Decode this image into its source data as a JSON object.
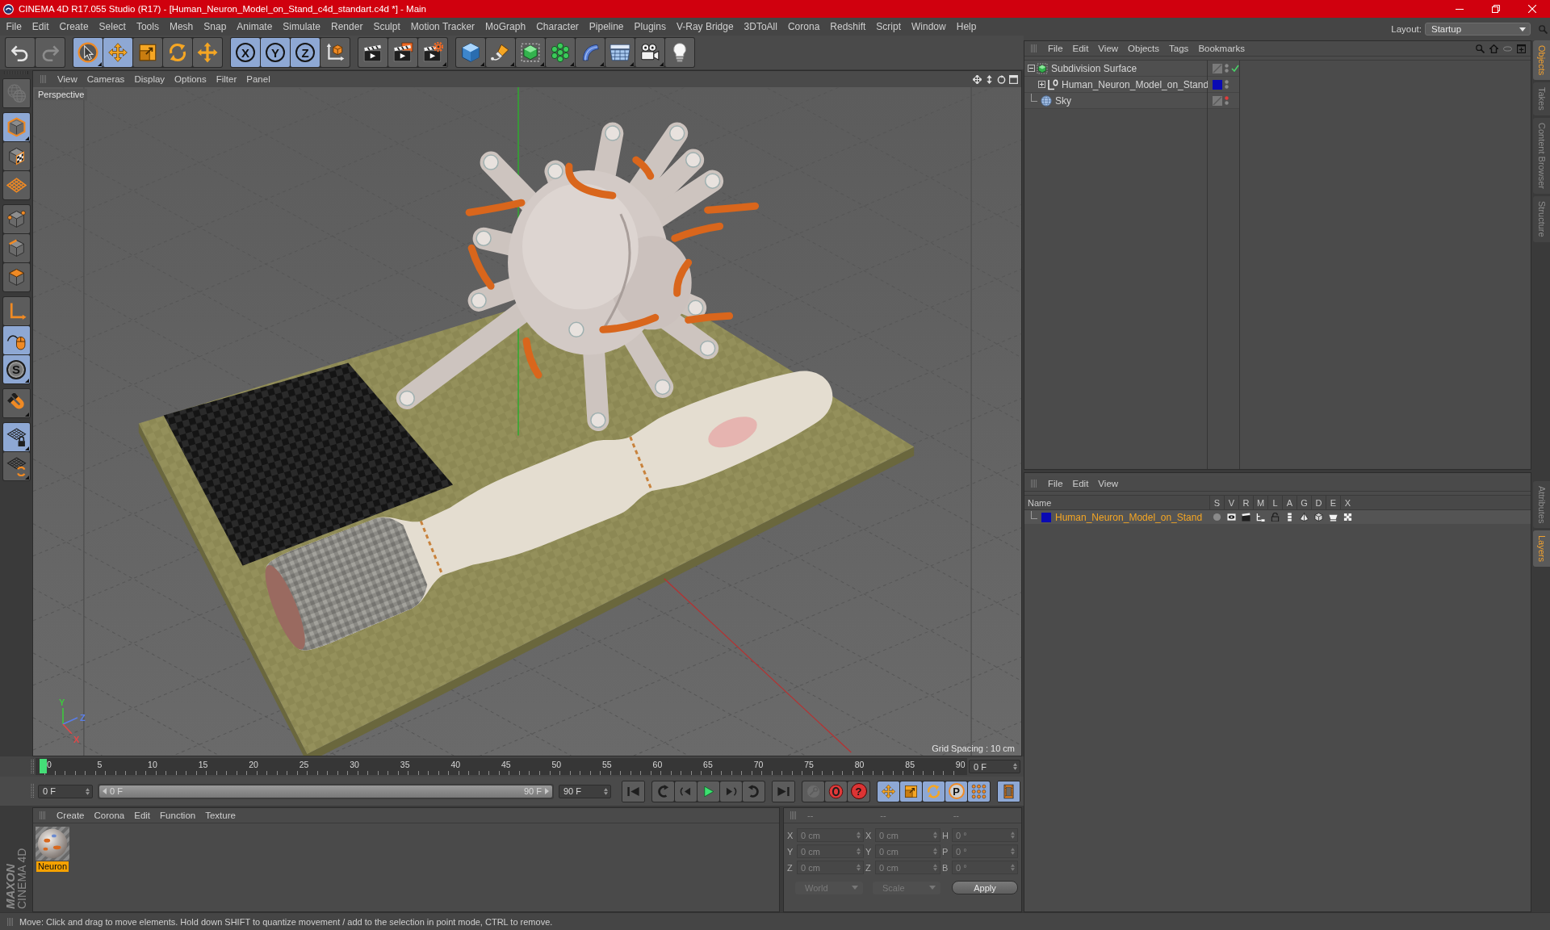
{
  "window": {
    "title": "CINEMA 4D R17.055 Studio (R17) - [Human_Neuron_Model_on_Stand_c4d_standart.c4d *] - Main"
  },
  "menu_bar": [
    "File",
    "Edit",
    "Create",
    "Select",
    "Tools",
    "Mesh",
    "Snap",
    "Animate",
    "Simulate",
    "Render",
    "Sculpt",
    "Motion Tracker",
    "MoGraph",
    "Character",
    "Pipeline",
    "Plugins",
    "V-Ray Bridge",
    "3DToAll",
    "Corona",
    "Redshift",
    "Script",
    "Window",
    "Help"
  ],
  "layout": {
    "label": "Layout:",
    "value": "Startup"
  },
  "toolbar": [
    [
      {
        "kind": "undo",
        "selected": false,
        "disabled": false
      },
      {
        "kind": "redo",
        "selected": false,
        "disabled": true
      }
    ],
    [
      {
        "kind": "select",
        "selected": true
      },
      {
        "kind": "move",
        "selected": true
      },
      {
        "kind": "scale",
        "selected": false
      },
      {
        "kind": "rotate",
        "selected": false
      },
      {
        "kind": "transform",
        "selected": false
      }
    ],
    [
      {
        "kind": "axis-lock",
        "label": "X",
        "selected": true
      },
      {
        "kind": "axis-lock",
        "label": "Y",
        "selected": true
      },
      {
        "kind": "axis-lock",
        "label": "Z",
        "selected": true
      },
      {
        "kind": "coordinate-system",
        "selected": false
      }
    ],
    [
      {
        "kind": "render-view",
        "selected": false
      },
      {
        "kind": "render-picture",
        "selected": false
      },
      {
        "kind": "render-settings",
        "selected": false
      }
    ],
    [
      {
        "kind": "cube",
        "selected": false
      },
      {
        "kind": "pen",
        "selected": false
      },
      {
        "kind": "subdivision",
        "selected": false
      },
      {
        "kind": "cloner",
        "selected": false
      },
      {
        "kind": "bend",
        "selected": false
      },
      {
        "kind": "floor",
        "selected": false
      },
      {
        "kind": "camera",
        "selected": false
      },
      {
        "kind": "light",
        "selected": false
      }
    ]
  ],
  "tool_palette": [
    [
      {
        "kind": "model-mode",
        "selected": false,
        "disabled": true
      }
    ],
    [
      {
        "kind": "object-mode",
        "selected": true
      },
      {
        "kind": "texture-mode",
        "selected": false
      },
      {
        "kind": "workplane-mode",
        "selected": false
      }
    ],
    [
      {
        "kind": "points-mode",
        "selected": false
      },
      {
        "kind": "edges-mode",
        "selected": false
      },
      {
        "kind": "polygons-mode",
        "selected": false
      }
    ],
    [
      {
        "kind": "axis-mode",
        "selected": false
      },
      {
        "kind": "tweak-mode",
        "selected": true
      },
      {
        "kind": "solo",
        "label": "S",
        "selected": true
      }
    ],
    [
      {
        "kind": "snap",
        "selected": false
      }
    ],
    [
      {
        "kind": "workplane-lock",
        "selected": true
      },
      {
        "kind": "planar-workplane",
        "selected": false
      }
    ]
  ],
  "viewport": {
    "menu": [
      "View",
      "Cameras",
      "Display",
      "Options",
      "Filter",
      "Panel"
    ],
    "camera": "Perspective",
    "grid_spacing": "Grid Spacing : 10 cm",
    "gizmo": [
      {
        "label": "Y",
        "color": "#3ec83e"
      },
      {
        "label": "Z",
        "color": "#5a7ee8"
      },
      {
        "label": "X",
        "color": "#e04848"
      }
    ]
  },
  "timeline": {
    "ticks": [
      "0",
      "5",
      "10",
      "15",
      "20",
      "25",
      "30",
      "35",
      "40",
      "45",
      "50",
      "55",
      "60",
      "65",
      "70",
      "75",
      "80",
      "85",
      "90"
    ],
    "playhead": {
      "level": 0
    },
    "current_frame": "0 F"
  },
  "playback": {
    "start": "0 F",
    "range": {
      "start": "0 F",
      "end": "90 F",
      "level": 1
    },
    "end": "90 F",
    "controls": [
      [
        {
          "kind": "go-start",
          "selected": false
        }
      ],
      [
        {
          "kind": "loop-back",
          "selected": false
        },
        {
          "kind": "step-back",
          "selected": false
        },
        {
          "kind": "play",
          "selected": false
        },
        {
          "kind": "step-forward",
          "selected": false
        },
        {
          "kind": "loop-forward",
          "selected": false
        }
      ],
      [
        {
          "kind": "go-end",
          "selected": false
        }
      ],
      [
        {
          "kind": "key",
          "selected": false,
          "disabled": true
        },
        {
          "kind": "record",
          "selected": false,
          "disabled": false
        },
        {
          "kind": "help",
          "label": "?",
          "selected": false,
          "disabled": false
        }
      ],
      [
        {
          "kind": "move",
          "selected": true
        },
        {
          "kind": "scale",
          "selected": true
        },
        {
          "kind": "rotate",
          "selected": true
        },
        {
          "kind": "parameter",
          "label": "P",
          "selected": true
        },
        {
          "kind": "point-level",
          "selected": true
        }
      ],
      [
        {
          "kind": "timeline",
          "selected": true
        }
      ]
    ]
  },
  "material_manager": {
    "menu": [
      "Create",
      "Corona",
      "Edit",
      "Function",
      "Texture"
    ],
    "materials": [
      {
        "name": "Neuron",
        "selected": true
      }
    ]
  },
  "logo": {
    "brand": "MAXON",
    "product": "CINEMA 4D"
  },
  "coordinates": {
    "disabled": true,
    "headers": [
      "--",
      "--",
      "--"
    ],
    "rows": [
      {
        "position_axis": "X",
        "position": "0 cm",
        "size_axis": "X",
        "size": "0 cm",
        "rotation_axis": "H",
        "rotation": "0 °"
      },
      {
        "position_axis": "Y",
        "position": "0 cm",
        "size_axis": "Y",
        "size": "0 cm",
        "rotation_axis": "P",
        "rotation": "0 °"
      },
      {
        "position_axis": "Z",
        "position": "0 cm",
        "size_axis": "Z",
        "size": "0 cm",
        "rotation_axis": "B",
        "rotation": "0 °"
      }
    ],
    "system": "World",
    "mode": "Scale",
    "apply": "Apply"
  },
  "object_manager": {
    "menu": [
      "File",
      "Edit",
      "View",
      "Objects",
      "Tags",
      "Bookmarks"
    ],
    "objects": [
      {
        "name": "Subdivision Surface",
        "kind": "subdivision",
        "expanded": true,
        "enabled": true,
        "hidden_in_editor": false,
        "children": [
          {
            "name": "Human_Neuron_Model_on_Stand",
            "kind": "null",
            "expanded": false,
            "hidden_in_editor": false,
            "color": "#0a0ab4"
          }
        ]
      },
      {
        "name": "Sky",
        "kind": "sky",
        "hidden_in_editor": true
      }
    ]
  },
  "layer_manager": {
    "menu": [
      "File",
      "Edit",
      "View"
    ],
    "columns": [
      "Name",
      "S",
      "V",
      "R",
      "M",
      "L",
      "A",
      "G",
      "D",
      "E",
      "X"
    ],
    "layers": [
      {
        "name": "Human_Neuron_Model_on_Stand",
        "color": "#0a0ab4",
        "selected": true
      }
    ]
  },
  "side_tabs": [
    {
      "label": "Objects",
      "selected": true
    },
    {
      "label": "Takes",
      "selected": false
    },
    {
      "label": "Content Browser",
      "selected": false
    },
    {
      "label": "Structure",
      "selected": false
    }
  ],
  "side_tabs_lower": [
    {
      "label": "Attributes",
      "selected": false
    },
    {
      "label": "Layers",
      "selected": true
    }
  ],
  "status_bar": "Move: Click and drag to move elements. Hold down SHIFT to quantize movement / add to the selection in point mode, CTRL to remove."
}
